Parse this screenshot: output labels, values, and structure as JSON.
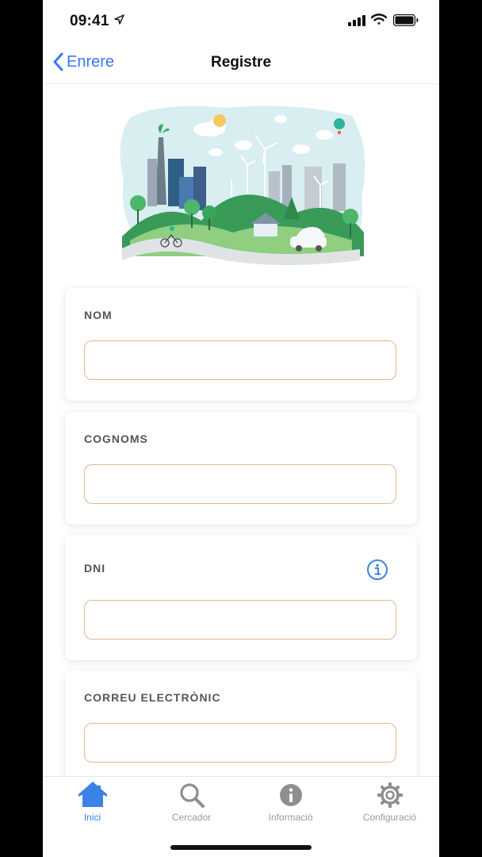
{
  "status_bar": {
    "time": "09:41"
  },
  "nav": {
    "back_label": "Enrere",
    "title": "Registre"
  },
  "form": {
    "fields": [
      {
        "label": "NOM",
        "value": "",
        "placeholder": ""
      },
      {
        "label": "COGNOMS",
        "value": "",
        "placeholder": ""
      },
      {
        "label": "DNI",
        "value": "",
        "placeholder": ""
      },
      {
        "label": "CORREU ELECTRÒNIC",
        "value": "",
        "placeholder": ""
      }
    ]
  },
  "tabs": [
    {
      "label": "Inici",
      "icon": "house-icon",
      "active": true
    },
    {
      "label": "Cercador",
      "icon": "magnifier-icon",
      "active": false
    },
    {
      "label": "Informació",
      "icon": "info-icon",
      "active": false
    },
    {
      "label": "Configuració",
      "icon": "gear-icon",
      "active": false
    }
  ],
  "colors": {
    "accent": "#3478f6",
    "field_border": "#e2b98e",
    "inactive_tab": "#9a9a9a"
  }
}
